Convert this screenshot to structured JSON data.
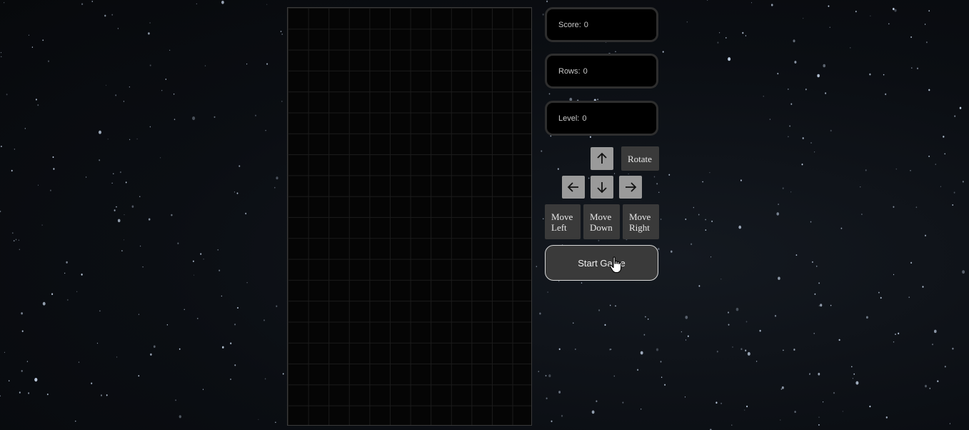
{
  "stats": {
    "score": {
      "label": "Score:",
      "value": "0"
    },
    "rows": {
      "label": "Rows:",
      "value": "0"
    },
    "level": {
      "label": "Level:",
      "value": "0"
    }
  },
  "controls": {
    "rotate_label": "Rotate",
    "move_left_line1": "Move",
    "move_left_line2": "Left",
    "move_down_line1": "Move",
    "move_down_line2": "Down",
    "move_right_line1": "Move",
    "move_right_line2": "Right",
    "up_icon": "arrow-up-icon",
    "left_icon": "arrow-left-icon",
    "down_icon": "arrow-down-icon",
    "right_icon": "arrow-right-icon"
  },
  "start_button": {
    "label": "Start Game"
  },
  "board": {
    "columns": 12,
    "rows": 20,
    "cells_filled": 0
  },
  "colors": {
    "board_background": "#050505",
    "stat_border": "#2e2e2e",
    "arrow_button": "#9a9a9a",
    "text_button": "#3a3a3a",
    "start_border": "#d8d8d8"
  }
}
